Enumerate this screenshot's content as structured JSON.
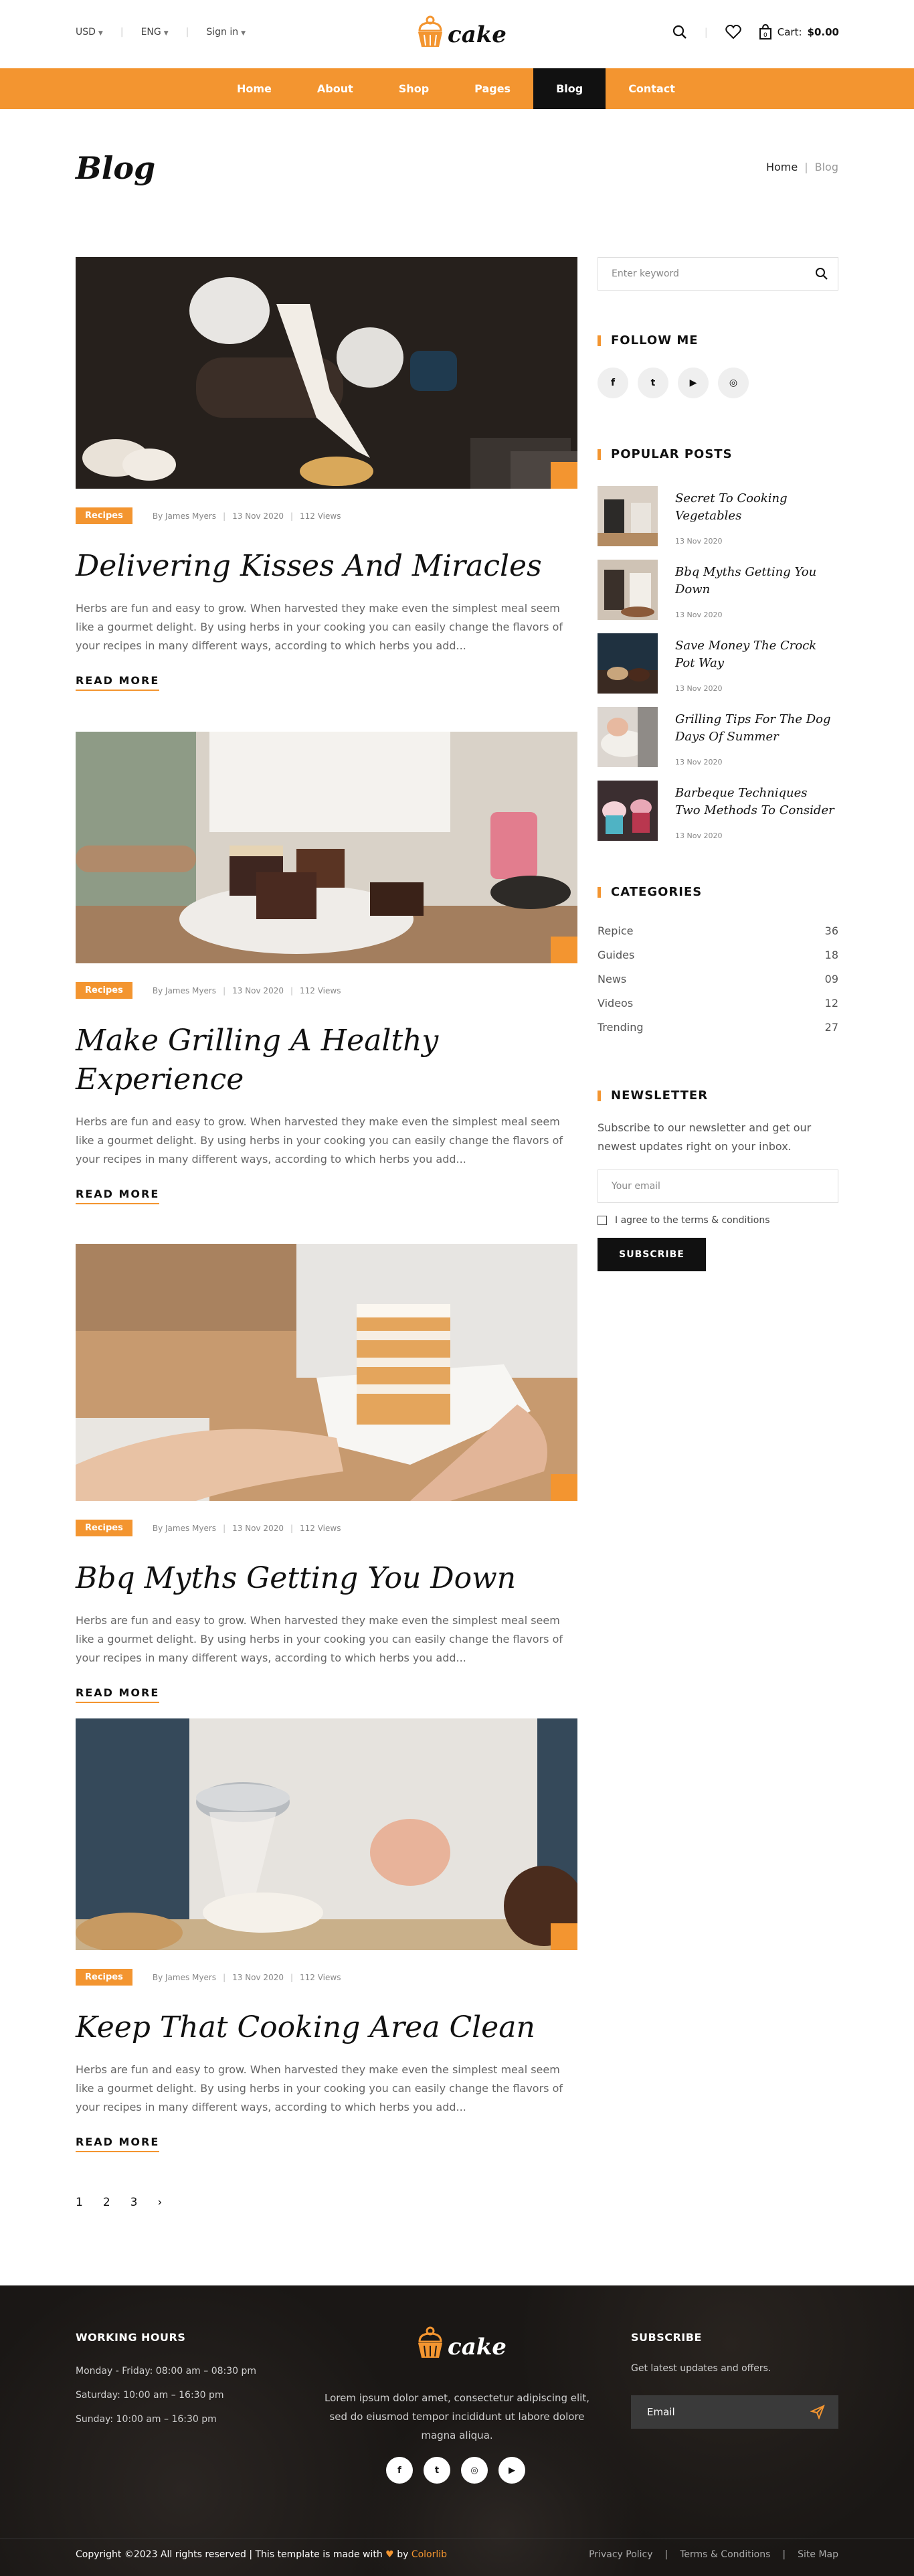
{
  "topbar": {
    "currency": "USD",
    "language": "ENG",
    "signin": "Sign in",
    "logo_text": "cake",
    "cart_label": "Cart:",
    "cart_amount": "$0.00"
  },
  "nav": {
    "items": [
      "Home",
      "About",
      "Shop",
      "Pages",
      "Blog",
      "Contact"
    ],
    "active": "Blog"
  },
  "page": {
    "title": "Blog",
    "breadcrumb_home": "Home",
    "breadcrumb_sep": "|",
    "breadcrumb_current": "Blog"
  },
  "posts": [
    {
      "tag": "Recipes",
      "author": "By James Myers",
      "date": "13 Nov 2020",
      "views": "112 Views",
      "title": "Delivering Kisses And Miracles",
      "excerpt": "Herbs are fun and easy to grow. When harvested they make even the simplest meal seem like a gourmet delight. By using herbs in your cooking you can easily change the flavors of your recipes in many different ways, according to which herbs you add...",
      "read_more": "READ MORE"
    },
    {
      "tag": "Recipes",
      "author": "By James Myers",
      "date": "13 Nov 2020",
      "views": "112 Views",
      "title": "Make Grilling A Healthy Experience",
      "excerpt": "Herbs are fun and easy to grow. When harvested they make even the simplest meal seem like a gourmet delight. By using herbs in your cooking you can easily change the flavors of your recipes in many different ways, according to which herbs you add...",
      "read_more": "READ MORE"
    },
    {
      "tag": "Recipes",
      "author": "By James Myers",
      "date": "13 Nov 2020",
      "views": "112 Views",
      "title": "Bbq Myths Getting You Down",
      "excerpt": "Herbs are fun and easy to grow. When harvested they make even the simplest meal seem like a gourmet delight. By using herbs in your cooking you can easily change the flavors of your recipes in many different ways, according to which herbs you add...",
      "read_more": "READ MORE"
    },
    {
      "tag": "Recipes",
      "author": "By James Myers",
      "date": "13 Nov 2020",
      "views": "112 Views",
      "title": "Keep That Cooking Area Clean",
      "excerpt": "Herbs are fun and easy to grow. When harvested they make even the simplest meal seem like a gourmet delight. By using herbs in your cooking you can easily change the flavors of your recipes in many different ways, according to which herbs you add...",
      "read_more": "READ MORE"
    }
  ],
  "pagination": [
    "1",
    "2",
    "3",
    "›"
  ],
  "sidebar": {
    "search_placeholder": "Enter keyword",
    "follow_title": "FOLLOW ME",
    "social": [
      "f",
      "t",
      "▶",
      "◎"
    ],
    "popular_title": "POPULAR POSTS",
    "popular": [
      {
        "title": "Secret To Cooking Vegetables",
        "date": "13 Nov 2020"
      },
      {
        "title": "Bbq Myths Getting You Down",
        "date": "13 Nov 2020"
      },
      {
        "title": "Save Money The Crock Pot Way",
        "date": "13 Nov 2020"
      },
      {
        "title": "Grilling Tips For The Dog Days Of Summer",
        "date": "13 Nov 2020"
      },
      {
        "title": "Barbeque Techniques Two Methods To Consider",
        "date": "13 Nov 2020"
      }
    ],
    "categories_title": "CATEGORIES",
    "categories": [
      {
        "name": "Repice",
        "count": "36"
      },
      {
        "name": "Guides",
        "count": "18"
      },
      {
        "name": "News",
        "count": "09"
      },
      {
        "name": "Videos",
        "count": "12"
      },
      {
        "name": "Trending",
        "count": "27"
      }
    ],
    "newsletter_title": "NEWSLETTER",
    "newsletter_text": "Subscribe to our newsletter and get our newest updates right on your inbox.",
    "email_placeholder": "Your email",
    "agree": "I agree to the terms & conditions",
    "subscribe_btn": "SUBSCRIBE"
  },
  "footer": {
    "hours_title": "WORKING HOURS",
    "hours": [
      "Monday - Friday: 08:00 am – 08:30 pm",
      "Saturday: 10:00 am – 16:30 pm",
      "Sunday: 10:00 am – 16:30 pm"
    ],
    "logo_text": "cake",
    "about": "Lorem ipsum dolor amet, consectetur adipiscing elit, sed do eiusmod tempor incididunt ut labore dolore magna aliqua.",
    "social": [
      "f",
      "t",
      "◎",
      "▶"
    ],
    "subscribe_title": "SUBSCRIBE",
    "subscribe_text": "Get latest updates and offers.",
    "email_placeholder": "Email",
    "copyright_pre": "Copyright ©2023 All rights reserved | This template is made with",
    "copyright_by": "by",
    "copyright_brand": "Colorlib",
    "links": [
      "Privacy Policy",
      "|",
      "Terms & Conditions",
      "|",
      "Site Map"
    ]
  },
  "colors": {
    "accent": "#f39530",
    "dark": "#111111",
    "footer_bg": "#1a1715"
  }
}
